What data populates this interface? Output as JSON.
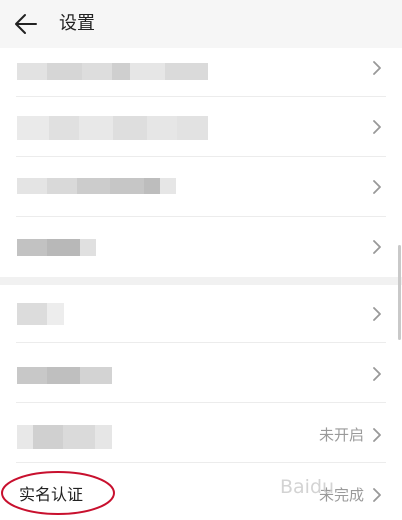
{
  "header": {
    "title": "设置",
    "back_icon": "arrow-left-icon"
  },
  "rows": [
    {
      "label": "",
      "value": "",
      "blurred": true
    },
    {
      "label": "",
      "value": "",
      "blurred": true
    },
    {
      "label": "",
      "value": "",
      "blurred": true
    },
    {
      "label": "",
      "value": "",
      "blurred": true
    },
    {
      "label": "",
      "value": "",
      "blurred": true
    },
    {
      "label": "",
      "value": "",
      "blurred": true
    },
    {
      "label": "",
      "value": "未开启",
      "blurred": true
    },
    {
      "label": "实名认证",
      "value": "未完成",
      "blurred": false
    }
  ],
  "watermark": "Baidu",
  "colors": {
    "annotation_red": "#c8102e",
    "chevron": "#999999",
    "value_text": "#9a9a9a"
  },
  "icons": {
    "row_chevron": "chevron-right-icon"
  }
}
